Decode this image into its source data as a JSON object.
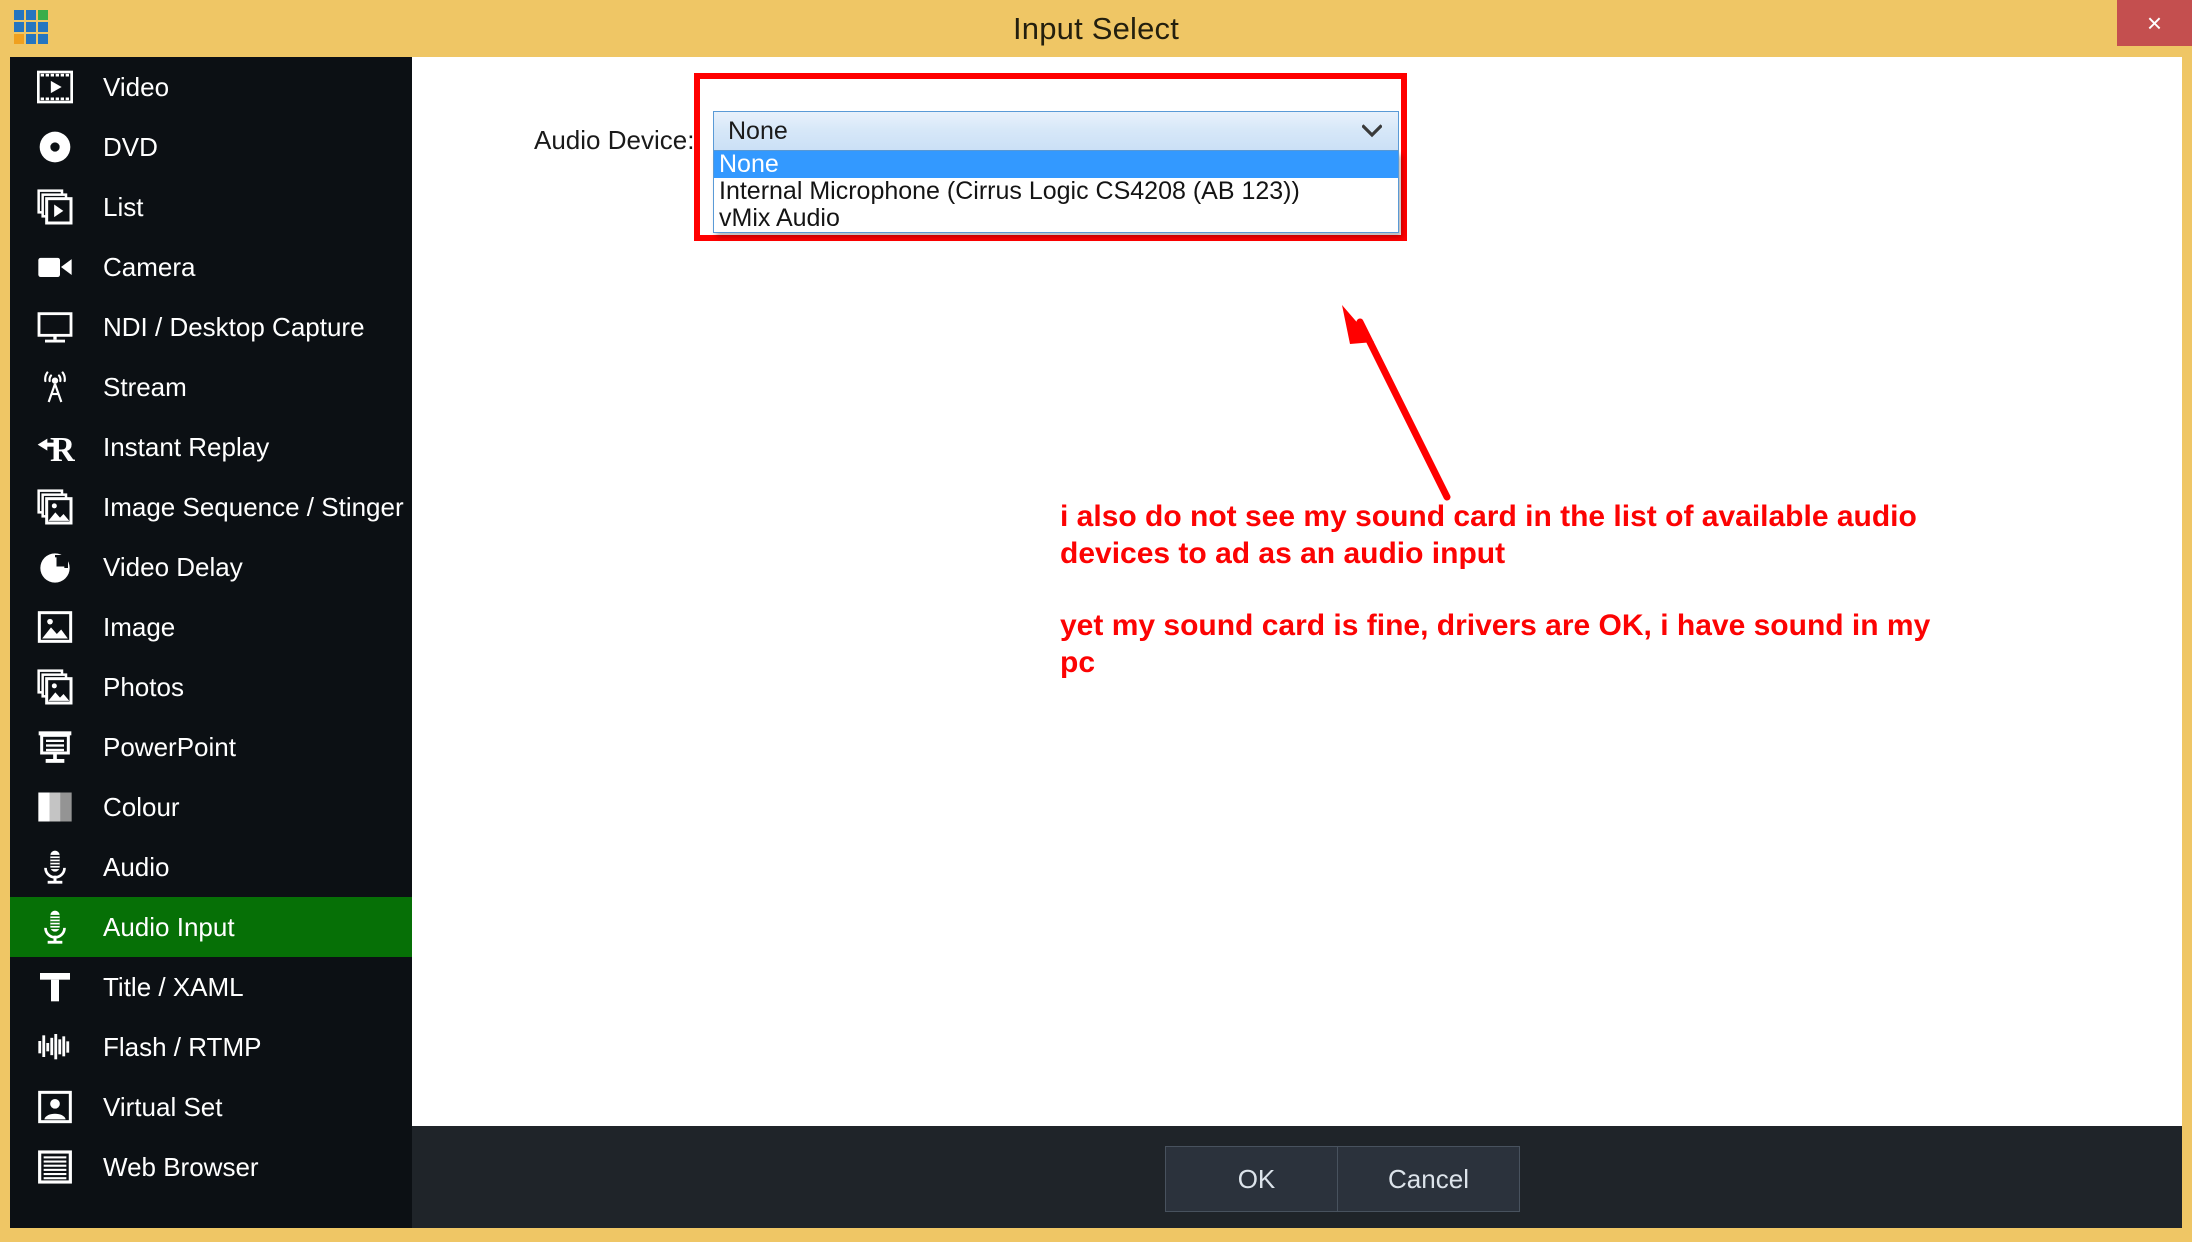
{
  "window": {
    "title": "Input Select",
    "close_label": "×",
    "accent_border": "#efc665",
    "logo_colors": [
      "#2575c0",
      "#2575c0",
      "#3aad4a",
      "#2575c0",
      "#2575c0",
      "#2575c0",
      "#f0a01e",
      "#2575c0",
      "#2575c0"
    ]
  },
  "sidebar": {
    "active_color": "#067006",
    "items": [
      {
        "label": "Video",
        "icon": "film-play-icon",
        "active": false
      },
      {
        "label": "DVD",
        "icon": "disc-icon",
        "active": false
      },
      {
        "label": "List",
        "icon": "stacked-play-icon",
        "active": false
      },
      {
        "label": "Camera",
        "icon": "camera-icon",
        "active": false
      },
      {
        "label": "NDI / Desktop Capture",
        "icon": "monitor-icon",
        "active": false
      },
      {
        "label": "Stream",
        "icon": "antenna-icon",
        "active": false
      },
      {
        "label": "Instant Replay",
        "icon": "replay-r-icon",
        "active": false
      },
      {
        "label": "Image Sequence / Stinger",
        "icon": "stacked-image-icon",
        "active": false
      },
      {
        "label": "Video Delay",
        "icon": "clock-icon",
        "active": false
      },
      {
        "label": "Image",
        "icon": "image-icon",
        "active": false
      },
      {
        "label": "Photos",
        "icon": "photos-icon",
        "active": false
      },
      {
        "label": "PowerPoint",
        "icon": "presentation-icon",
        "active": false
      },
      {
        "label": "Colour",
        "icon": "colour-swatch-icon",
        "active": false
      },
      {
        "label": "Audio",
        "icon": "microphone-icon",
        "active": false
      },
      {
        "label": "Audio Input",
        "icon": "microphone-icon",
        "active": true
      },
      {
        "label": "Title / XAML",
        "icon": "text-t-icon",
        "active": false
      },
      {
        "label": "Flash / RTMP",
        "icon": "waveform-icon",
        "active": false
      },
      {
        "label": "Virtual Set",
        "icon": "person-frame-icon",
        "active": false
      },
      {
        "label": "Web Browser",
        "icon": "lines-page-icon",
        "active": false
      }
    ]
  },
  "main": {
    "audio_device_label": "Audio Device:",
    "combo": {
      "selected_value": "None",
      "chevron_icon": "chevron-down-icon",
      "options": [
        {
          "label": "None",
          "selected": true
        },
        {
          "label": "Internal Microphone (Cirrus Logic CS4208 (AB 123))",
          "selected": false
        },
        {
          "label": "vMix Audio",
          "selected": false
        }
      ]
    },
    "annotation": {
      "color": "#fc0303",
      "arrow_icon": "red-arrow-annotation",
      "paragraphs": [
        "i also do not see my sound card in the list of available audio devices to ad as an audio input",
        "yet my sound card is fine, drivers are OK, i have sound in my pc"
      ]
    },
    "highlight_box_color": "#ff0000"
  },
  "footer": {
    "ok_label": "OK",
    "cancel_label": "Cancel"
  }
}
